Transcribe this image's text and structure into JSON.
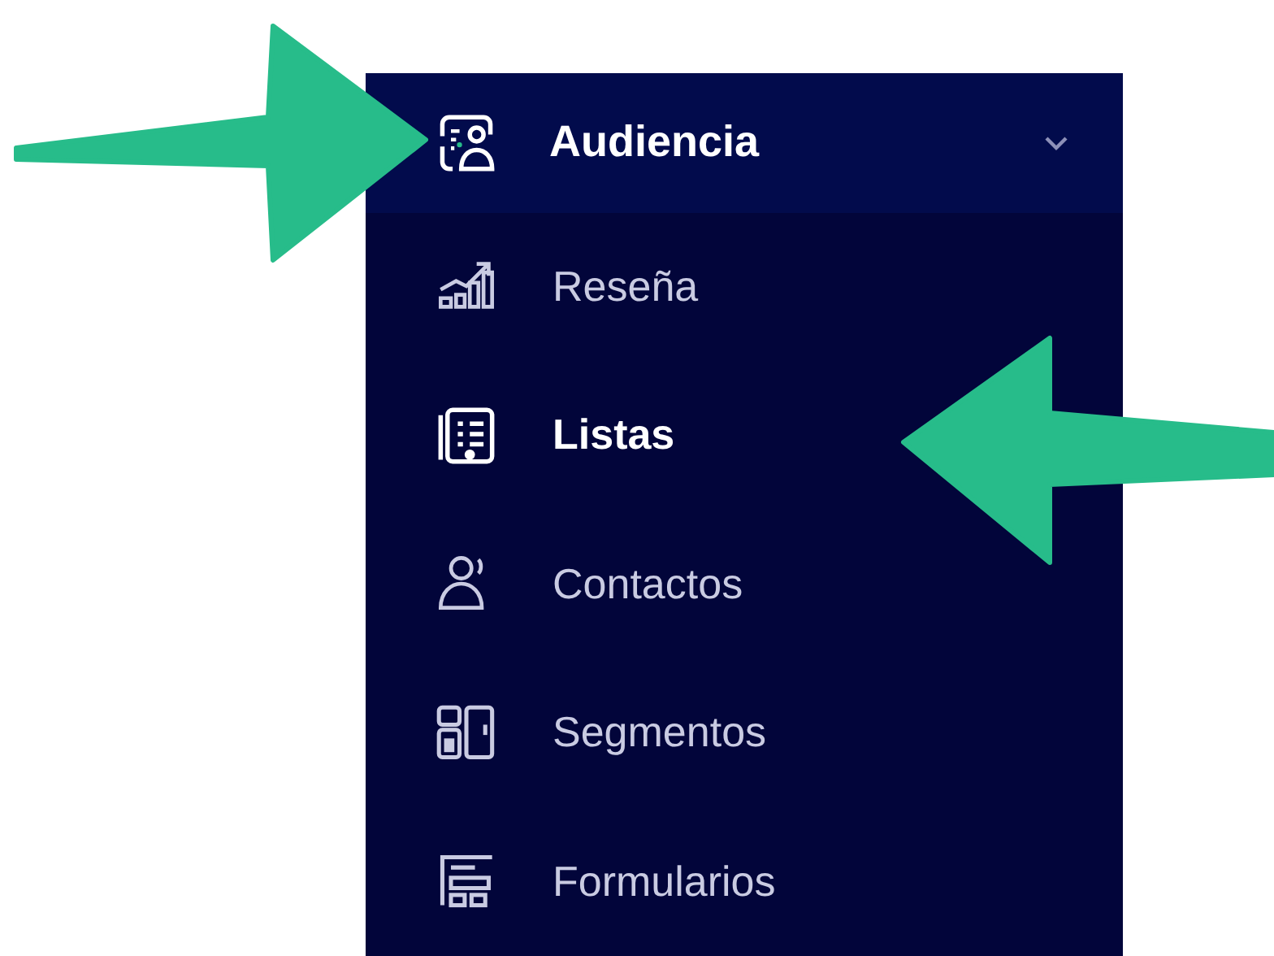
{
  "sidebar": {
    "group": {
      "label": "Audiencia",
      "expanded": true
    },
    "items": [
      {
        "label": "Reseña",
        "selected": false
      },
      {
        "label": "Listas",
        "selected": true
      },
      {
        "label": "Contactos",
        "selected": false
      },
      {
        "label": "Segmentos",
        "selected": false
      },
      {
        "label": "Formularios",
        "selected": false
      }
    ]
  }
}
